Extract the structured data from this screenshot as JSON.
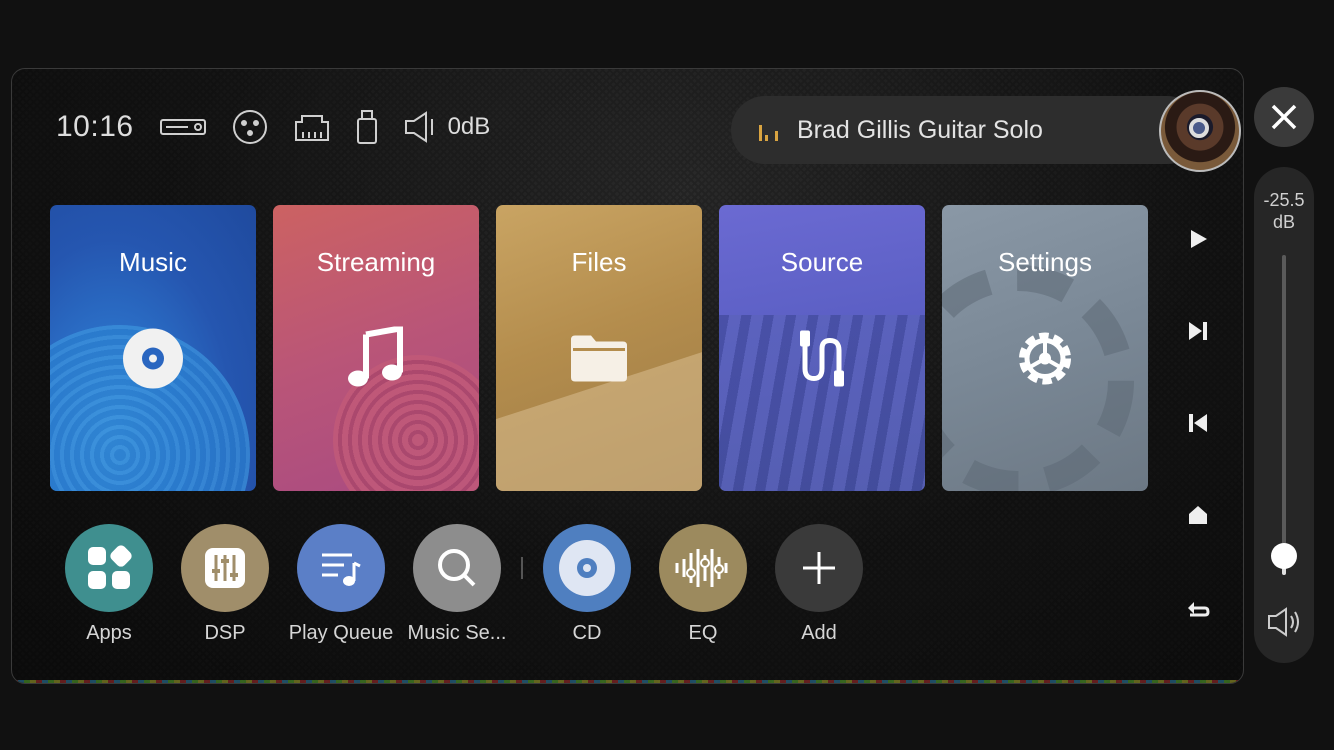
{
  "status": {
    "time": "10:16",
    "volume_level": "0dB",
    "icons": [
      "input-device-icon",
      "xlr-icon",
      "ethernet-icon",
      "usb-icon",
      "speaker-icon"
    ]
  },
  "now_playing": {
    "title": "Brad Gillis Guitar Solo"
  },
  "cards": [
    {
      "label": "Music",
      "icon": "disc-icon"
    },
    {
      "label": "Streaming",
      "icon": "music-note-icon"
    },
    {
      "label": "Files",
      "icon": "folder-icon"
    },
    {
      "label": "Source",
      "icon": "cable-icon"
    },
    {
      "label": "Settings",
      "icon": "gear-icon"
    }
  ],
  "side_controls": [
    "play-icon",
    "next-track-icon",
    "previous-track-icon",
    "eject-icon",
    "back-icon"
  ],
  "dock": [
    {
      "label": "Apps",
      "color": "#3f8f8f"
    },
    {
      "label": "DSP",
      "color": "#a08e6a"
    },
    {
      "label": "Play Queue",
      "color": "#5b7fc7"
    },
    {
      "label": "Music Se...",
      "color": "#8d8d8d"
    },
    {
      "label": "CD",
      "color": "#4f7fc0"
    },
    {
      "label": "EQ",
      "color": "#9c8a5e"
    },
    {
      "label": "Add",
      "color": "#3a3a3a"
    }
  ],
  "volume": {
    "value": "-25.5",
    "unit": "dB",
    "level_fraction": 0.06
  }
}
